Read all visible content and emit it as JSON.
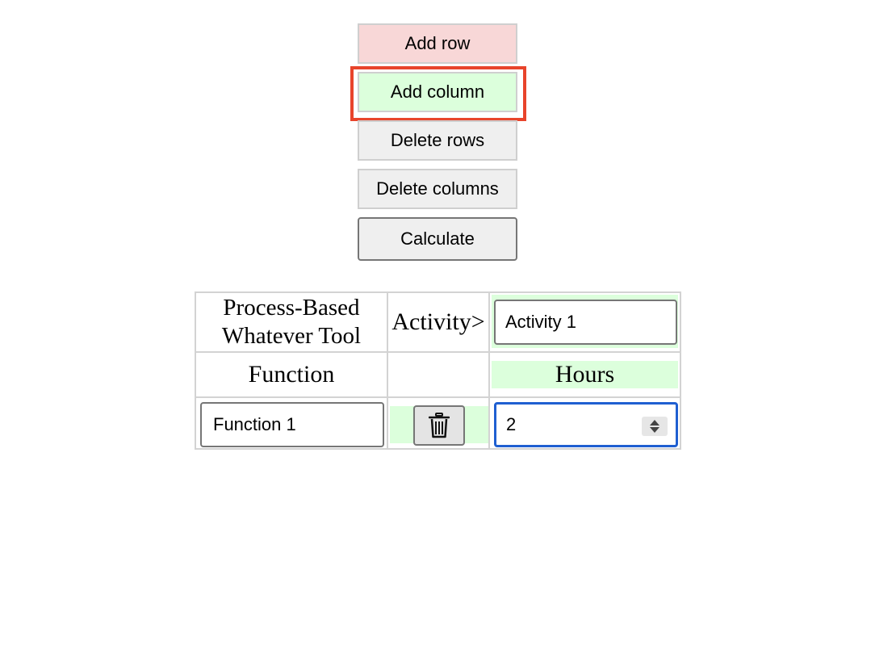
{
  "toolbar": {
    "add_row_label": "Add row",
    "add_column_label": "Add column",
    "delete_rows_label": "Delete rows",
    "delete_columns_label": "Delete columns",
    "calculate_label": "Calculate"
  },
  "table": {
    "title_line1": "Process-Based",
    "title_line2": "Whatever Tool",
    "activity_label": "Activity>",
    "function_header": "Function",
    "hours_header": "Hours",
    "activities": [
      {
        "name": "Activity 1"
      }
    ],
    "rows": [
      {
        "function": "Function 1",
        "hours": "2"
      }
    ]
  },
  "icons": {
    "delete_row": "trash-icon",
    "spinner": "spinner-arrows-icon"
  },
  "colors": {
    "add_row_bg": "#f8d7d7",
    "add_column_bg": "#dcffdc",
    "highlight_border": "#e8442b",
    "focus_border": "#1f5fd1"
  }
}
